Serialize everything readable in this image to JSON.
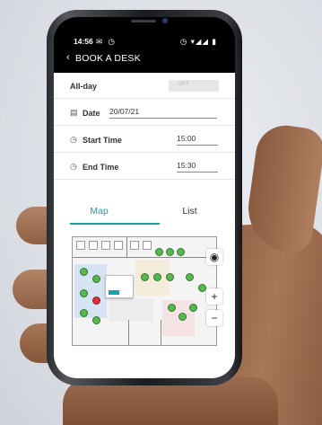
{
  "status": {
    "time": "14:56",
    "left_icons": "✉ ◷",
    "right_icons": "◷ ▾◢◢ ▮"
  },
  "appbar": {
    "back": "‹",
    "title": "BOOK A DESK"
  },
  "all_day": {
    "label": "All-day",
    "toggle": "OFF"
  },
  "date": {
    "label": "Date",
    "value": "20/07/21"
  },
  "start_time": {
    "label": "Start Time",
    "value": "15:00"
  },
  "end_time": {
    "label": "End Time",
    "value": "15:30"
  },
  "tabs": {
    "map": "Map",
    "list": "List",
    "active": "Map"
  },
  "map_controls": {
    "view": "◉",
    "zoom_in": "+",
    "zoom_out": "−"
  },
  "accent_color": "#1aa3ad"
}
